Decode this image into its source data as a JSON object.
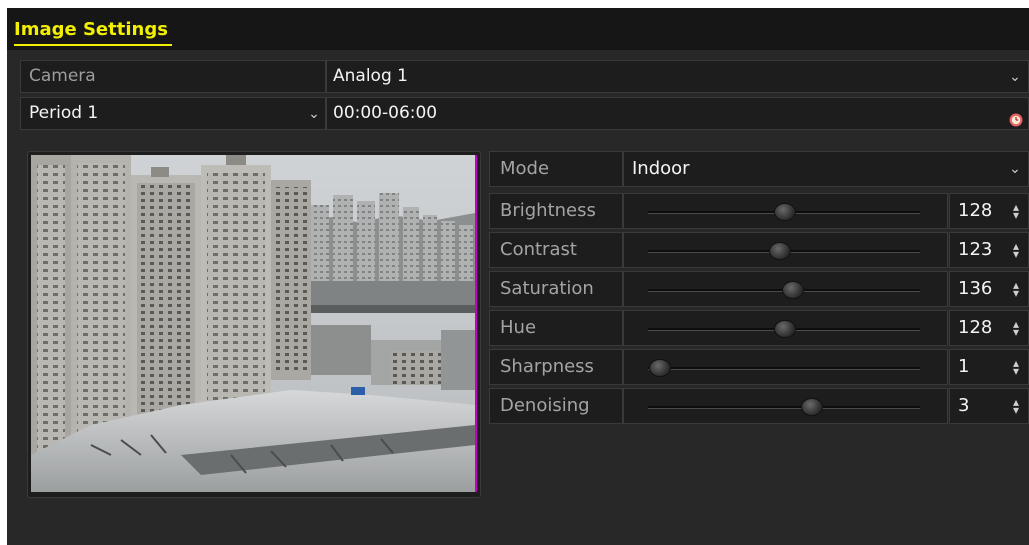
{
  "window": {
    "title": "Image Settings"
  },
  "camera": {
    "label": "Camera",
    "value": "Analog 1"
  },
  "period": {
    "value": "Period 1",
    "time_range": "00:00-06:00"
  },
  "mode": {
    "label": "Mode",
    "value": "Indoor"
  },
  "settings": [
    {
      "label": "Brightness",
      "value": "128",
      "level": 0.5
    },
    {
      "label": "Contrast",
      "value": "123",
      "level": 0.48
    },
    {
      "label": "Saturation",
      "value": "136",
      "level": 0.53
    },
    {
      "label": "Hue",
      "value": "128",
      "level": 0.5
    },
    {
      "label": "Sharpness",
      "value": "1",
      "level": 0.04
    },
    {
      "label": "Denoising",
      "value": "3",
      "level": 0.6
    }
  ],
  "icons": {
    "dropdown": "chevron-down-icon",
    "clock": "clock-icon",
    "spinner": "spinner-arrows-icon"
  },
  "colors": {
    "title_accent": "#f2f000",
    "background": "#282828",
    "titlebar": "#161616",
    "field": "#1d1d1d",
    "preview_edge": "#c300c3"
  }
}
